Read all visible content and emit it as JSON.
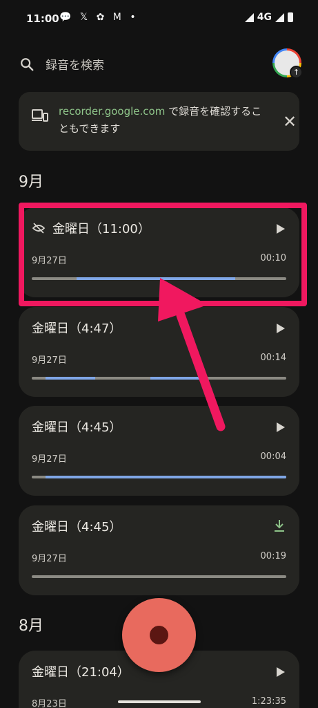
{
  "status_bar": {
    "time": "11:00",
    "notifications": "💬 𝕏 ✿ M •",
    "network": "4G"
  },
  "search": {
    "placeholder": "録音を検索"
  },
  "banner": {
    "link_text": "recorder.google.com",
    "text_rest": " で録音を確認することもできます",
    "close_glyph": "✕"
  },
  "sections": [
    {
      "label": "9月"
    },
    {
      "label": "8月"
    }
  ],
  "recordings": [
    {
      "title": "金曜日（11:00）",
      "date": "9月27日",
      "duration": "00:10",
      "action": "play",
      "hidden_icon": true,
      "segments": [
        [
          0.175,
          0.8
        ]
      ]
    },
    {
      "title": "金曜日（4:47）",
      "date": "9月27日",
      "duration": "00:14",
      "action": "play",
      "hidden_icon": false,
      "segments": [
        [
          0.055,
          0.25
        ],
        [
          0.465,
          0.665
        ]
      ]
    },
    {
      "title": "金曜日（4:45）",
      "date": "9月27日",
      "duration": "00:04",
      "action": "play",
      "hidden_icon": false,
      "segments": [
        [
          0.055,
          1.0
        ]
      ]
    },
    {
      "title": "金曜日（4:45）",
      "date": "9月27日",
      "duration": "00:19",
      "action": "download",
      "hidden_icon": false,
      "segments": []
    },
    {
      "title": "金曜日（21:04）",
      "date": "8月23日",
      "duration": "1:23:35",
      "action": "play",
      "hidden_icon": false,
      "segments": []
    }
  ],
  "colors": {
    "accent_bar": "#7fa6e6",
    "highlight": "#f0185f",
    "record_button": "#e86a5e",
    "link": "#8fc58a"
  }
}
